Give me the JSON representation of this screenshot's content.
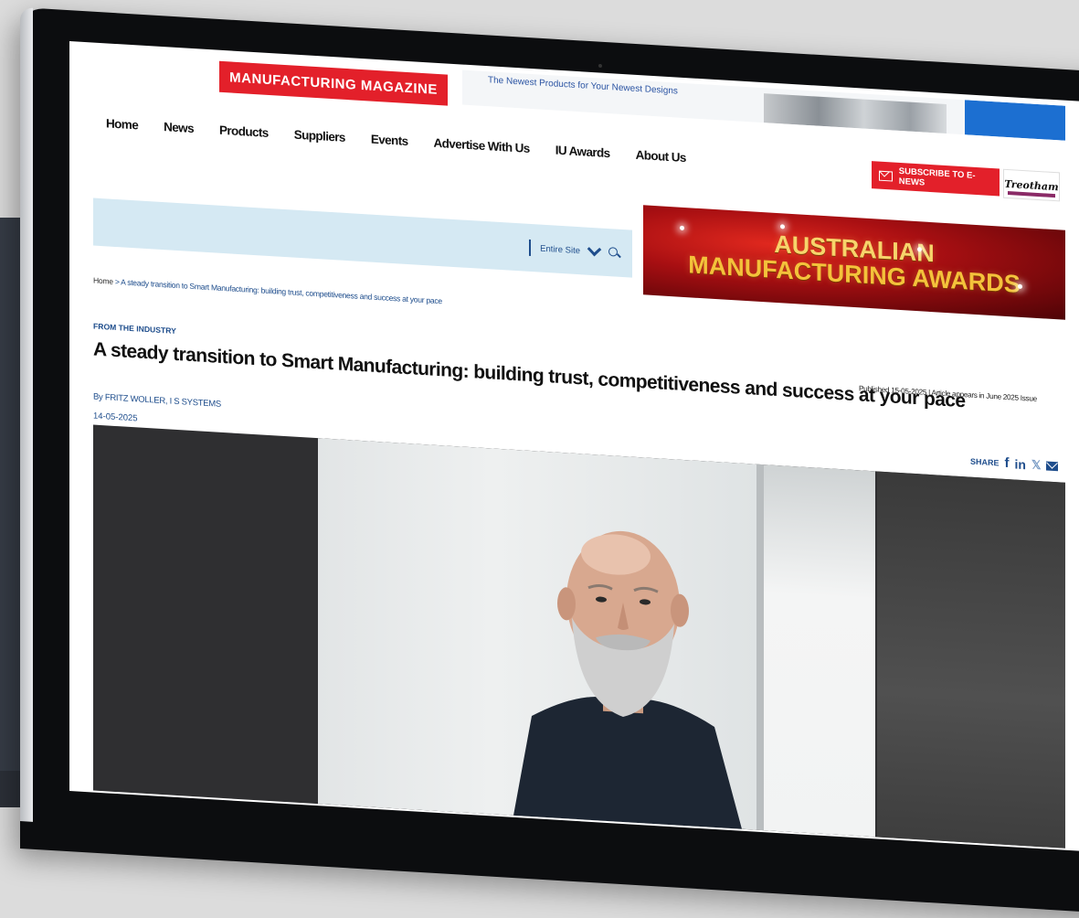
{
  "site": {
    "logo": "MANUFACTURING MAGAZINE",
    "top_banner_tagline": "The Newest Products for Your Newest Designs"
  },
  "nav": {
    "items": [
      "Home",
      "News",
      "Products",
      "Suppliers",
      "Events",
      "Advertise With Us",
      "IU Awards",
      "About Us"
    ]
  },
  "header": {
    "subscribe_label": "SUBSCRIBE TO E-NEWS",
    "sponsor_logo": "Treotham"
  },
  "search": {
    "scope": "Entire Site"
  },
  "ad": {
    "line1": "AUSTRALIAN",
    "line2": "MANUFACTURING AWARDS"
  },
  "breadcrumb": {
    "home": "Home",
    "separator": ">",
    "current": "A steady transition to Smart Manufacturing: building trust, competitiveness and success at your pace"
  },
  "article": {
    "category": "FROM THE INDUSTRY",
    "title": "A steady transition to Smart Manufacturing: building trust, competitiveness and success at your pace",
    "published": "Published 15-05-2025 | Article appears in June 2025 Issue",
    "byline": "By FRITZ WOLLER, I S SYSTEMS",
    "date": "14-05-2025"
  },
  "share": {
    "label": "SHARE",
    "icons": [
      "facebook-icon",
      "linkedin-icon",
      "x-icon",
      "email-icon"
    ]
  },
  "colors": {
    "brand_red": "#e3202a",
    "link_blue": "#1e4d8c",
    "search_bg": "#d5e9f3"
  }
}
